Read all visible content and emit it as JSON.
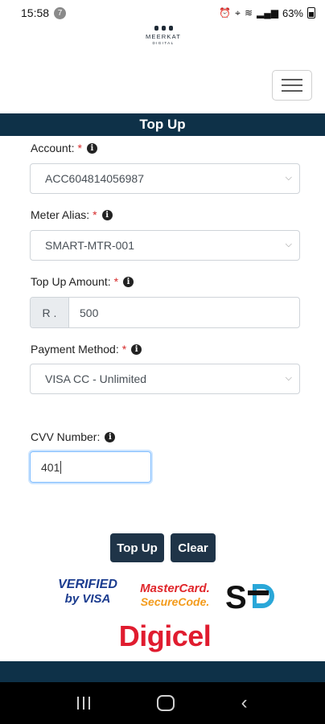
{
  "status_bar": {
    "time": "15:58",
    "notification_count": "7",
    "battery": "63%"
  },
  "header": {
    "logo_name": "MEERKAT",
    "logo_sub": "DIGITAL"
  },
  "page_title": "Top Up",
  "form": {
    "account": {
      "label": "Account:",
      "required": "*",
      "value": "ACC604814056987"
    },
    "meter_alias": {
      "label": "Meter Alias:",
      "required": "*",
      "value": "SMART-MTR-001"
    },
    "top_up_amount": {
      "label": "Top Up Amount:",
      "required": "*",
      "prefix": "R .",
      "value": "500"
    },
    "payment_method": {
      "label": "Payment Method:",
      "required": "*",
      "value": "VISA CC - Unlimited"
    },
    "cvv": {
      "label": "CVV Number:",
      "value": "401"
    }
  },
  "buttons": {
    "top_up": "Top Up",
    "clear": "Clear"
  },
  "logos": {
    "visa_top": "VERIFIED",
    "visa_bottom": "by VISA",
    "mastercard_top": "MasterCard.",
    "mastercard_bottom": "SecureCode.",
    "digicel": "Digicel"
  },
  "colors": {
    "navy": "#0e3148",
    "button": "#1f3448",
    "required": "#d62b2b",
    "digicel_red": "#e01c2f"
  }
}
